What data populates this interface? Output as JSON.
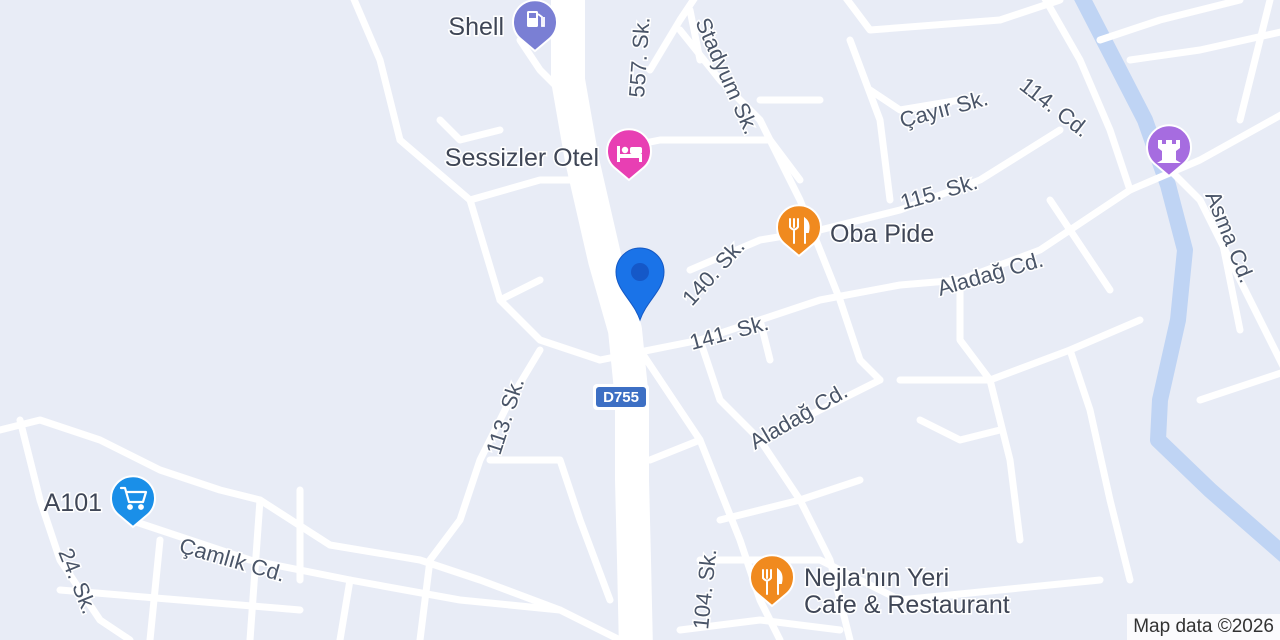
{
  "map": {
    "colors": {
      "land": "#e8ecf6",
      "road": "#ffffff",
      "water": "#bfd4f4",
      "food_pin": "#f08a1f",
      "lodging_pin": "#e83fb3",
      "fuel_pin": "#7a7fd4",
      "shopping_pin": "#1a8fe8",
      "landmark_pin": "#a66ce0",
      "location_pin": "#1a73e8"
    },
    "street_labels": {
      "s557": "557. Sk.",
      "stadyum": "Stadyum Sk.",
      "cayir": "Çayır Sk.",
      "cd114": "114. Cd.",
      "sk115": "115. Sk.",
      "sk140": "140. Sk.",
      "aladag1": "Aladağ Cd.",
      "sk141": "141. Sk.",
      "asma": "Asma Cd.",
      "sk113": "113. Sk.",
      "aladag2": "Aladağ Cd.",
      "camlik": "Çamlık Cd.",
      "sk24": "24. Sk.",
      "sk104": "104. Sk."
    },
    "road_shield": "D755",
    "pois": {
      "shell": {
        "name": "Shell",
        "icon": "gas-station-icon"
      },
      "sessizler": {
        "name": "Sessizler Otel",
        "icon": "hotel-bed-icon"
      },
      "oba": {
        "name": "Oba Pide",
        "icon": "restaurant-icon"
      },
      "a101": {
        "name": "A101",
        "icon": "shopping-cart-icon"
      },
      "nejla": {
        "name_line1": "Nejla'nın Yeri",
        "name_line2": "Cafe & Restaurant",
        "icon": "restaurant-icon"
      },
      "landmark": {
        "icon": "castle-icon"
      }
    },
    "attribution": "Map data ©2026"
  }
}
